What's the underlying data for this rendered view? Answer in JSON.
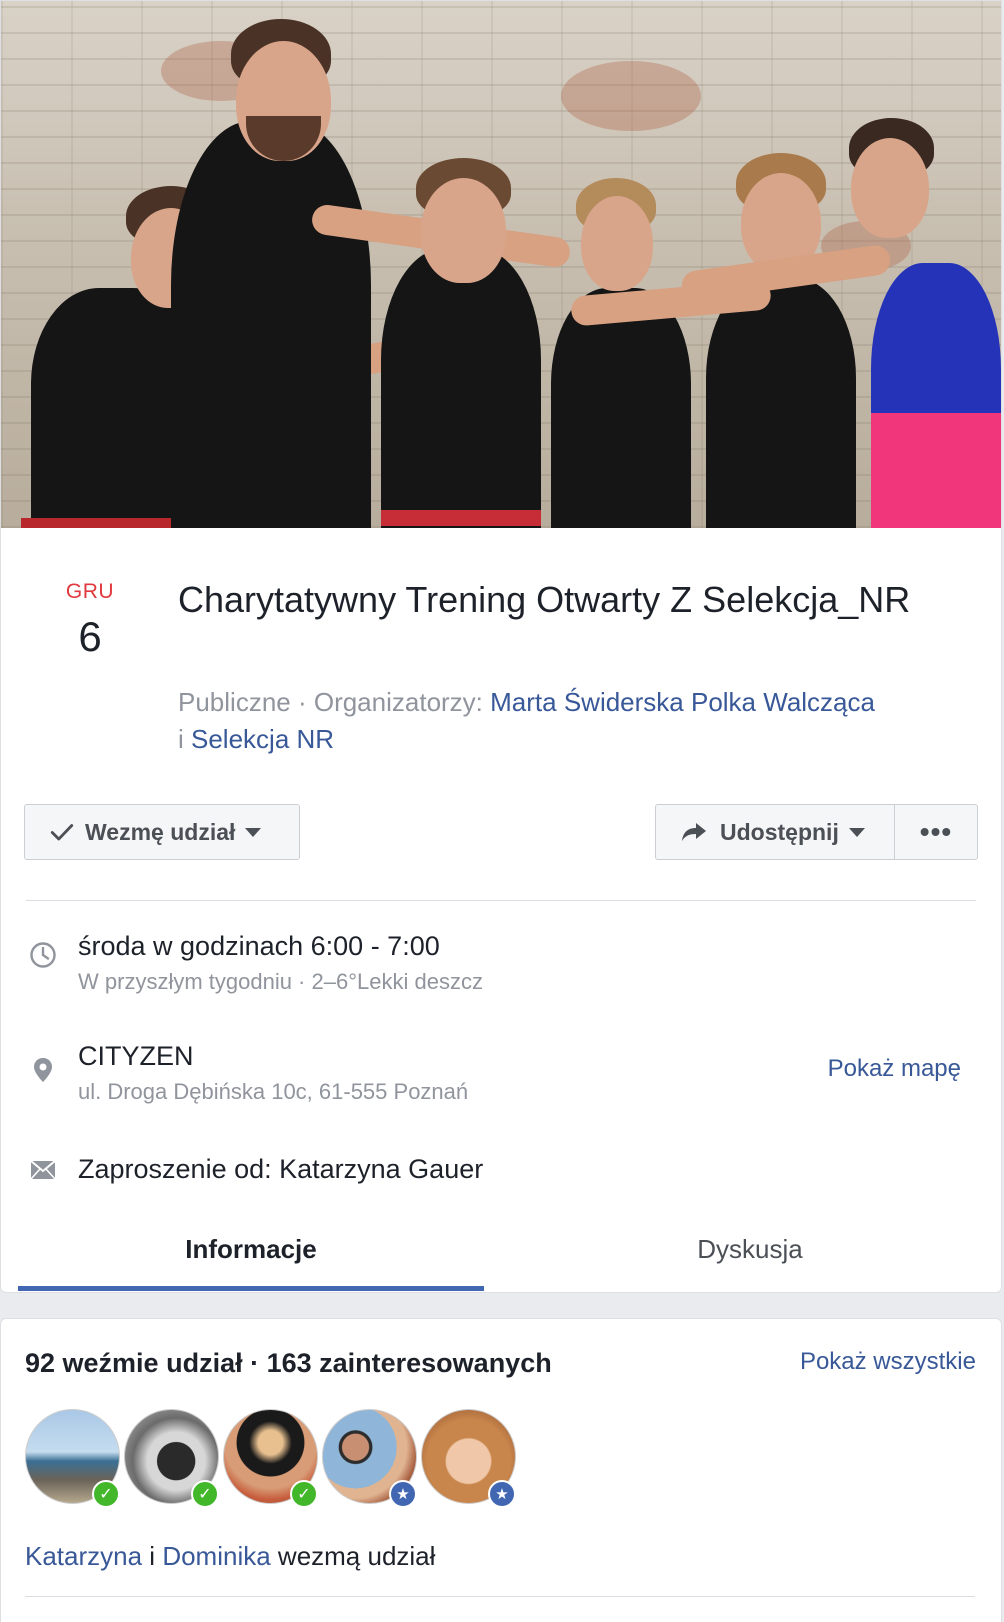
{
  "event": {
    "month": "GRU",
    "day": "6",
    "title": "Charytatywny Trening Otwarty Z Selekcja_NR",
    "privacy": "Publiczne",
    "separator": " · ",
    "organizers_label": "Organizatorzy: ",
    "organizer_1": "Marta Świderska Polka Walcząca",
    "organizer_join": "i ",
    "organizer_2": "Selekcja NR"
  },
  "actions": {
    "going_label": "Wezmę udział",
    "share_label": "Udostępnij",
    "more_label": "•••"
  },
  "details": {
    "time_main": "środa w godzinach 6:00 - 7:00",
    "time_sub": "W przyszłym tygodniu · 2–6°Lekki deszcz",
    "place_main": "CITYZEN",
    "place_sub": "ul. Droga Dębińska 10c, 61-555 Poznań",
    "map_link": "Pokaż mapę",
    "invite": "Zaproszenie od: Katarzyna Gauer"
  },
  "tabs": {
    "info": "Informacje",
    "discussion": "Dyskusja"
  },
  "attendees": {
    "counts": "92 weźmie udział · 163 zainteresowanych",
    "show_all": "Pokaż wszystkie",
    "name_1": "Katarzyna",
    "join": " i ",
    "name_2": "Dominika",
    "suffix": " wezmą udział"
  },
  "colors": {
    "link": "#385898",
    "accent": "#4267b2",
    "month_red": "#e0393e",
    "going_green": "#42b72a"
  }
}
